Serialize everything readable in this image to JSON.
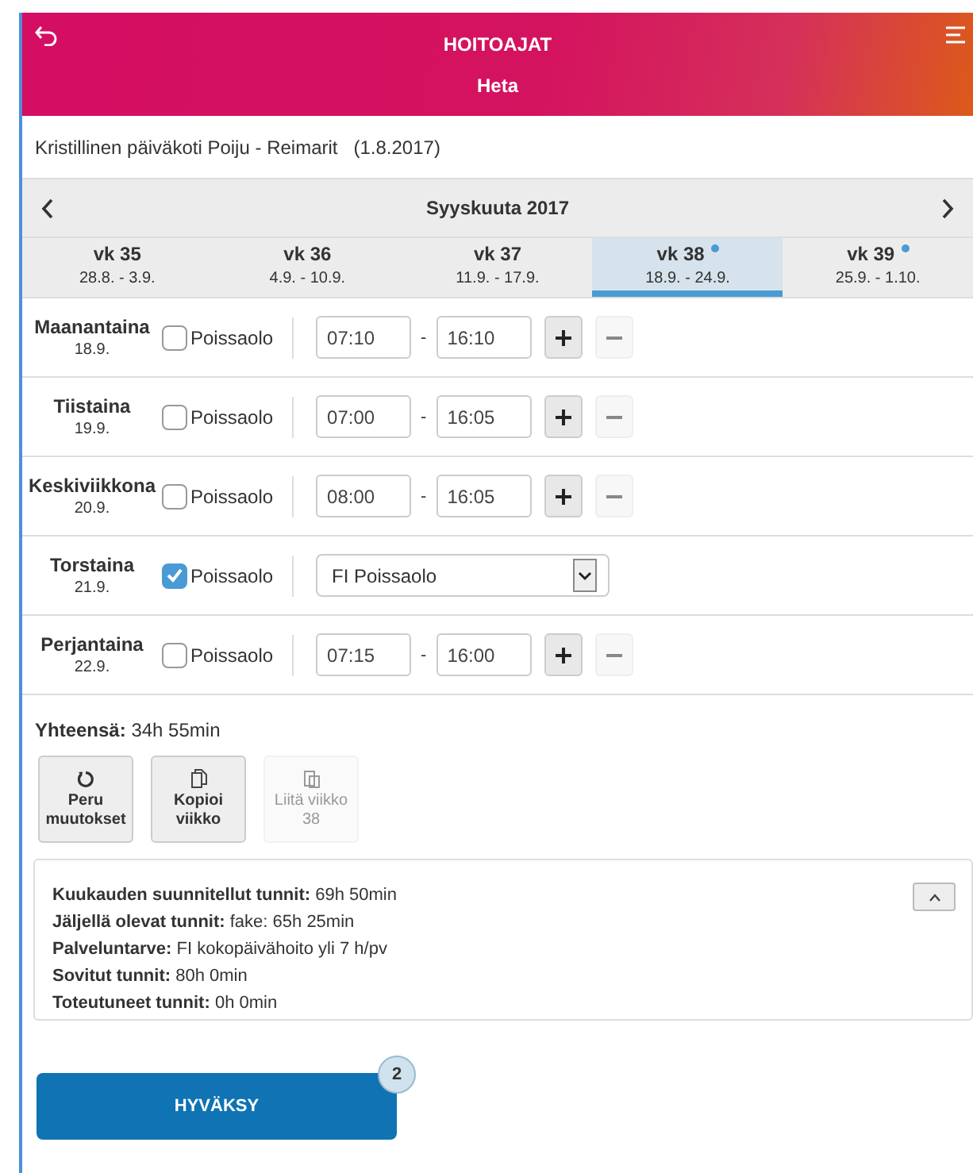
{
  "header": {
    "title": "HOITOAJAT",
    "subtitle": "Heta"
  },
  "org": "Kristillinen päiväkoti Poiju - Reimarit   (1.8.2017)",
  "month": {
    "title": "Syyskuuta 2017"
  },
  "weeks": [
    {
      "label": "vk 35",
      "range": "28.8. - 3.9.",
      "selected": false,
      "marked": false
    },
    {
      "label": "vk 36",
      "range": "4.9. - 10.9.",
      "selected": false,
      "marked": false
    },
    {
      "label": "vk 37",
      "range": "11.9. - 17.9.",
      "selected": false,
      "marked": false
    },
    {
      "label": "vk 38",
      "range": "18.9. - 24.9.",
      "selected": true,
      "marked": true
    },
    {
      "label": "vk 39",
      "range": "25.9. - 1.10.",
      "selected": false,
      "marked": true
    }
  ],
  "days": [
    {
      "name": "Maanantaina",
      "date": "18.9.",
      "absence_label": "Poissaolo",
      "absent": false,
      "start": "07:10",
      "separator": "-",
      "end": "16:10"
    },
    {
      "name": "Tiistaina",
      "date": "19.9.",
      "absence_label": "Poissaolo",
      "absent": false,
      "start": "07:00",
      "separator": "-",
      "end": "16:05"
    },
    {
      "name": "Keskiviikkona",
      "date": "20.9.",
      "absence_label": "Poissaolo",
      "absent": false,
      "start": "08:00",
      "separator": "-",
      "end": "16:05"
    },
    {
      "name": "Torstaina",
      "date": "21.9.",
      "absence_label": "Poissaolo",
      "absent": true,
      "reason": "FI Poissaolo"
    },
    {
      "name": "Perjantaina",
      "date": "22.9.",
      "absence_label": "Poissaolo",
      "absent": false,
      "start": "07:15",
      "separator": "-",
      "end": "16:00"
    }
  ],
  "total": {
    "label": "Yhteensä:",
    "value": "34h 55min"
  },
  "actions": [
    {
      "kind": "undo",
      "label": "Peru muutokset",
      "disabled": false
    },
    {
      "kind": "copy",
      "label": "Kopioi viikko",
      "disabled": false
    },
    {
      "kind": "paste",
      "label": "Liitä viikko 38",
      "disabled": true
    }
  ],
  "summary": {
    "expanded": true,
    "lines": [
      {
        "label": "Kuukauden suunnitellut tunnit:",
        "value": "69h 50min"
      },
      {
        "label": "Jäljellä olevat tunnit:",
        "value": "fake: 65h 25min"
      },
      {
        "label": "Palveluntarve:",
        "value": "FI kokopäivähoito yli 7 h/pv"
      },
      {
        "label": "Sovitut tunnit:",
        "value": "80h 0min"
      },
      {
        "label": "Toteutuneet tunnit:",
        "value": "0h 0min"
      }
    ]
  },
  "approve": {
    "label": "HYVÄKSY",
    "badge": "2"
  }
}
